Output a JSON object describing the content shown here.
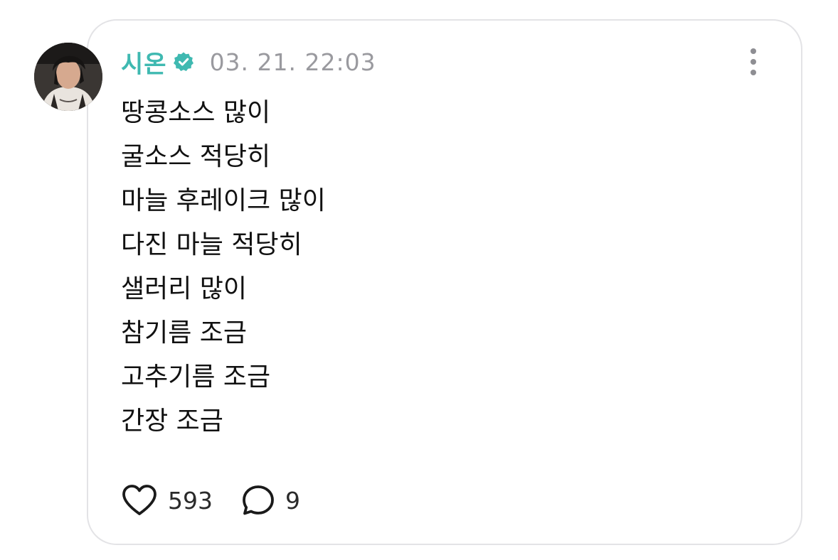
{
  "post": {
    "author": {
      "name": "시온",
      "verified": true,
      "avatar_icon": "profile-photo"
    },
    "timestamp": "03. 21. 22:03",
    "lines": [
      "땅콩소스 많이",
      "굴소스 적당히",
      "마늘 후레이크 많이",
      "다진 마늘 적당히",
      "샐러리 많이",
      "참기름 조금",
      "고추기름 조금",
      "간장 조금"
    ],
    "likes": "593",
    "replies": "9"
  },
  "icons": {
    "more": "more-vertical-icon",
    "like": "heart-icon",
    "reply": "speech-bubble-icon",
    "verified": "verified-badge-icon"
  },
  "colors": {
    "brand_teal": "#3fb9b1",
    "muted": "#9a9a9f",
    "text": "#111111",
    "border": "#e3e3e6"
  }
}
